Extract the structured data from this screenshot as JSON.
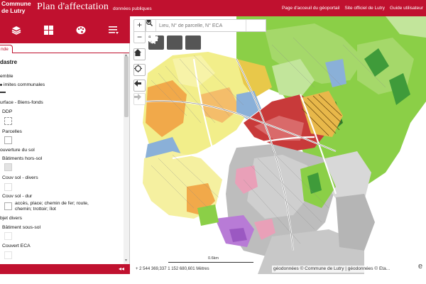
{
  "header": {
    "logo_line1": "Commune",
    "logo_line2": "de Lutry",
    "title": "Plan d'affectation",
    "subtitle": "données publiques",
    "links": [
      "Page d'acceuil du géoportail",
      "Site officiel de Lutry",
      "Guide utilisateur"
    ]
  },
  "toolbar": {
    "icons": [
      "layers-icon",
      "grid-icon",
      "palette-icon",
      "list-icon"
    ]
  },
  "sidebar": {
    "tab_label": "nde",
    "heading": "dastre",
    "items": {
      "ensemble": "emble",
      "limites": "imites communales",
      "surface": "urface - Biens-fonds",
      "ddp": "DDP",
      "parcelles": "Parcelles",
      "couverture": "ouverture du sol",
      "batiments": "Bâtiments hors-sol",
      "couv_divers": "Couv sol - divers",
      "couv_dur": "Couv sol - dur",
      "couv_dur_desc1": "accès, place; chemin de fer; route,",
      "couv_dur_desc2": "chemin; trottoir; îlot",
      "objet_divers": "bjet divers",
      "bat_sous_sol": "Bâtiment sous-sol",
      "couvert_eca": "Couvert ECA"
    },
    "collapse_label": "◂◂"
  },
  "map": {
    "search_placeholder": "Lieu, N° de parcelle, N° ECA",
    "coordinates": "2 544 369,337 1 152 680,601 Mètres",
    "scale_label": "0.6km",
    "attribution": "géodonnées © Commune de Lutry | géodonnées © Eta...",
    "corner": "e",
    "colors": {
      "brand": "#c0112f",
      "forest": "#8bcf47",
      "village": "#f2ee8a",
      "residential_orange": "#f1a94a",
      "dense_red": "#c83a3a",
      "blue_zone": "#8ab0d8",
      "gray_zone": "#bdbdbd",
      "purple_zone": "#b87bd6"
    }
  }
}
